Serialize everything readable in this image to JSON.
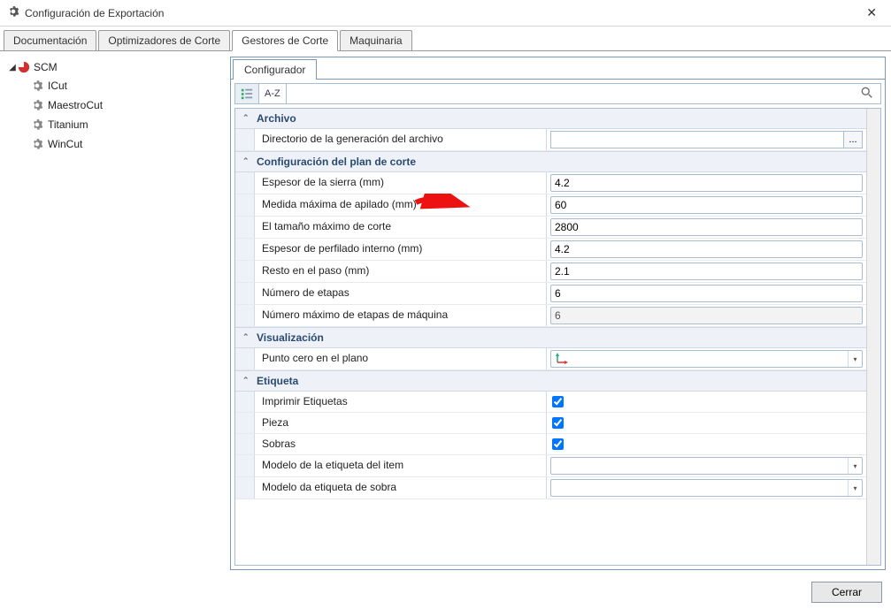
{
  "window": {
    "title": "Configuración de Exportación"
  },
  "tabs": {
    "items": [
      "Documentación",
      "Optimizadores de Corte",
      "Gestores de Corte",
      "Maquinaria"
    ],
    "active_index": 2
  },
  "tree": {
    "root": "SCM",
    "children": [
      "ICut",
      "MaestroCut",
      "Titanium",
      "WinCut"
    ],
    "selected_index": 0
  },
  "subtabs": {
    "items": [
      "Configurador"
    ],
    "active_index": 0
  },
  "toolbar": {
    "categorized_tooltip": "Categorizado",
    "alpha_label": "A-Z",
    "search_placeholder": ""
  },
  "categories": [
    {
      "name": "Archivo",
      "props": [
        {
          "label": "Directorio de la generación del archivo",
          "type": "browse",
          "value": ""
        }
      ]
    },
    {
      "name": "Configuración del plan de corte",
      "props": [
        {
          "label": "Espesor de la sierra (mm)",
          "type": "text",
          "value": "4.2"
        },
        {
          "label": "Medida máxima de apilado (mm)",
          "type": "text",
          "value": "60",
          "highlight": true
        },
        {
          "label": "El tamaño máximo de corte",
          "type": "text",
          "value": "2800"
        },
        {
          "label": "Espesor de perfilado interno (mm)",
          "type": "text",
          "value": "4.2"
        },
        {
          "label": "Resto en el paso (mm)",
          "type": "text",
          "value": "2.1"
        },
        {
          "label": "Número de etapas",
          "type": "text",
          "value": "6"
        },
        {
          "label": "Número máximo de etapas de máquina",
          "type": "text",
          "value": "6",
          "readonly": true
        }
      ]
    },
    {
      "name": "Visualización",
      "props": [
        {
          "label": "Punto cero en el plano",
          "type": "origin_dropdown",
          "value": ""
        }
      ]
    },
    {
      "name": "Etiqueta",
      "props": [
        {
          "label": "Imprimir Etiquetas",
          "type": "check",
          "value": true
        },
        {
          "label": "Pieza",
          "type": "check",
          "value": true
        },
        {
          "label": "Sobras",
          "type": "check",
          "value": true
        },
        {
          "label": "Modelo de la etiqueta del item",
          "type": "dropdown",
          "value": ""
        },
        {
          "label": "Modelo da etiqueta de sobra",
          "type": "dropdown",
          "value": ""
        }
      ]
    }
  ],
  "footer": {
    "close_label": "Cerrar"
  }
}
